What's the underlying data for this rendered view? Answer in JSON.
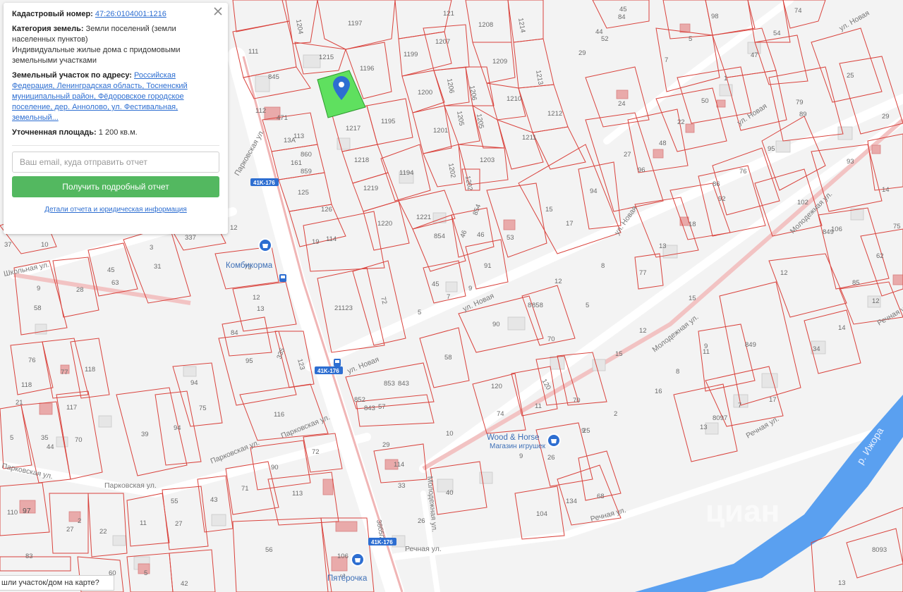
{
  "info_card": {
    "cadastral_label": "Кадастровый номер:",
    "cadastral_number": "47:26:0104001:1216",
    "category_label": "Категория земель:",
    "category_value": "Земли поселений (земли населенных пунктов)",
    "usage_value": "Индивидуальные жилые дома с придомовыми земельными участками",
    "address_label": "Земельный участок по адресу:",
    "address_value": "Российская Федерация, Ленинградская область, Тосненский муниципальный район, Фёдоровское городское поселение, дер. Аннолово, ул. Фестивальная, земельный...",
    "area_label": "Уточненная площадь:",
    "area_value": "1 200 кв.м.",
    "email_placeholder": "Ваш email, куда отправить отчет",
    "report_button": "Получить подробный отчет",
    "details_link": "Детали отчета и юридическая информация"
  },
  "bottom_bar": {
    "text": "шли участок/дом на карте?"
  },
  "map": {
    "selected_parcel_color": "#5fe05f",
    "parcel_stroke_color": "#d9423c",
    "river_color": "#5aa0f0",
    "pois": [
      {
        "name": "Комбикорма",
        "icon": "map-pin-icon"
      },
      {
        "name": "Wood & Horse",
        "subtitle": "Магазин игрушек",
        "icon": "map-pin-icon"
      },
      {
        "name": "Пятёрочка",
        "icon": "map-pin-icon"
      }
    ],
    "road_badges": [
      "41K-176",
      "41K-176",
      "41K-176"
    ],
    "streets": [
      "ул. Новая",
      "ул. Новая",
      "ул. Новая",
      "ул. Новая",
      "ул. Новая",
      "Молодежная ул.",
      "Молодежная ул.",
      "Парковская ул.",
      "Парковская ул.",
      "Парковская ул.",
      "Речная ул.",
      "Речная ул.",
      "Речная ул.",
      "Речная ул.",
      "Школьная ул.",
      "Молодежная ул.",
      "38б5/2"
    ],
    "river_label": "р. Ижора",
    "watermark": "циан",
    "parcel_numbers": [
      "1197",
      "1215",
      "1196",
      "845",
      "111",
      "1204",
      "121",
      "1208",
      "1214",
      "1199",
      "1207",
      "1209",
      "1213",
      "1200",
      "1206",
      "1206",
      "1210",
      "1212",
      "1201",
      "1205",
      "1205",
      "1211",
      "1202",
      "1203",
      "1202",
      "1217",
      "1195",
      "1218",
      "1194",
      "1219",
      "1220",
      "1221",
      "112",
      "471",
      "113",
      "13А",
      "860",
      "161",
      "859",
      "125",
      "126",
      "114",
      "854",
      "854",
      "46",
      "46",
      "53",
      "91",
      "45",
      "7",
      "9",
      "19",
      "15",
      "17",
      "94",
      "337",
      "12",
      "37",
      "45",
      "63",
      "28",
      "31",
      "3",
      "10",
      "58",
      "9",
      "73",
      "13",
      "12",
      "84",
      "95",
      "335",
      "123",
      "123",
      "72",
      "5",
      "21",
      "858",
      "843",
      "853",
      "852",
      "843",
      "57",
      "58",
      "90",
      "70",
      "120",
      "120",
      "11",
      "70",
      "74",
      "39",
      "94",
      "94",
      "75",
      "76",
      "77",
      "118",
      "118",
      "21",
      "117",
      "35",
      "5",
      "44",
      "70",
      "116",
      "114",
      "90",
      "113",
      "72",
      "71",
      "43",
      "40",
      "104",
      "134",
      "68",
      "26",
      "110",
      "97",
      "2",
      "27",
      "22",
      "11",
      "27",
      "55",
      "56",
      "106",
      "3",
      "83",
      "60",
      "42",
      "5",
      "9",
      "25",
      "29",
      "33",
      "26",
      "98",
      "5",
      "54",
      "74",
      "45",
      "84",
      "29",
      "44",
      "52",
      "7",
      "47",
      "1",
      "25",
      "50",
      "24",
      "22",
      "79",
      "89",
      "29",
      "48",
      "27",
      "96",
      "95",
      "76",
      "93",
      "92",
      "18",
      "86",
      "14",
      "13",
      "77",
      "102",
      "106",
      "62",
      "85",
      "75",
      "12",
      "14",
      "12",
      "849",
      "849",
      "17",
      "9",
      "11",
      "34",
      "13",
      "16",
      "15",
      "8",
      "8",
      "8097",
      "8093",
      "13",
      "12",
      "15",
      "2",
      "10",
      "12",
      "8",
      "5",
      "9",
      "7"
    ]
  }
}
